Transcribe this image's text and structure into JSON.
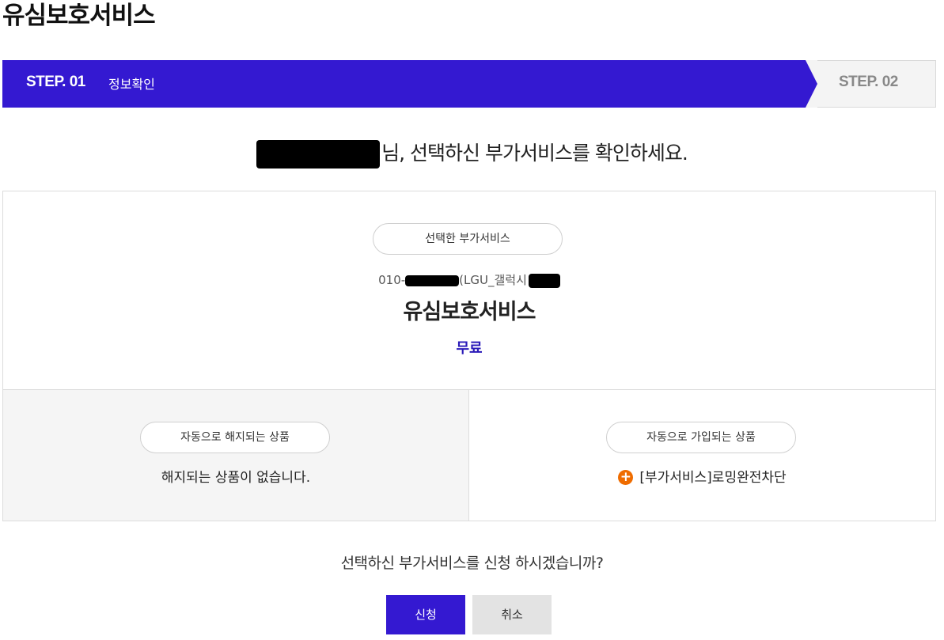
{
  "page": {
    "title": "유심보호서비스"
  },
  "steps": {
    "step1_number": "STEP. 01",
    "step1_label": "정보확인",
    "step2_number": "STEP. 02"
  },
  "greeting": {
    "suffix": "님, 선택하신 부가서비스를 확인하세요."
  },
  "selected": {
    "pill_label": "선택한 부가서비스",
    "phone_prefix": "010-",
    "device_info": "(LGU_갤럭시",
    "service_name": "유심보호서비스",
    "price": "무료"
  },
  "terminated": {
    "pill_label": "자동으로 해지되는 상품",
    "message": "해지되는 상품이 없습니다."
  },
  "subscribed": {
    "pill_label": "자동으로 가입되는 상품",
    "item": "[부가서비스]로밍완전차단"
  },
  "confirm": {
    "question": "선택하신 부가서비스를 신청 하시겠습니까?",
    "apply_label": "신청",
    "cancel_label": "취소"
  },
  "colors": {
    "brand": "#3419d1",
    "price": "#2a1ab8",
    "plus_icon": "#ef6c00"
  }
}
